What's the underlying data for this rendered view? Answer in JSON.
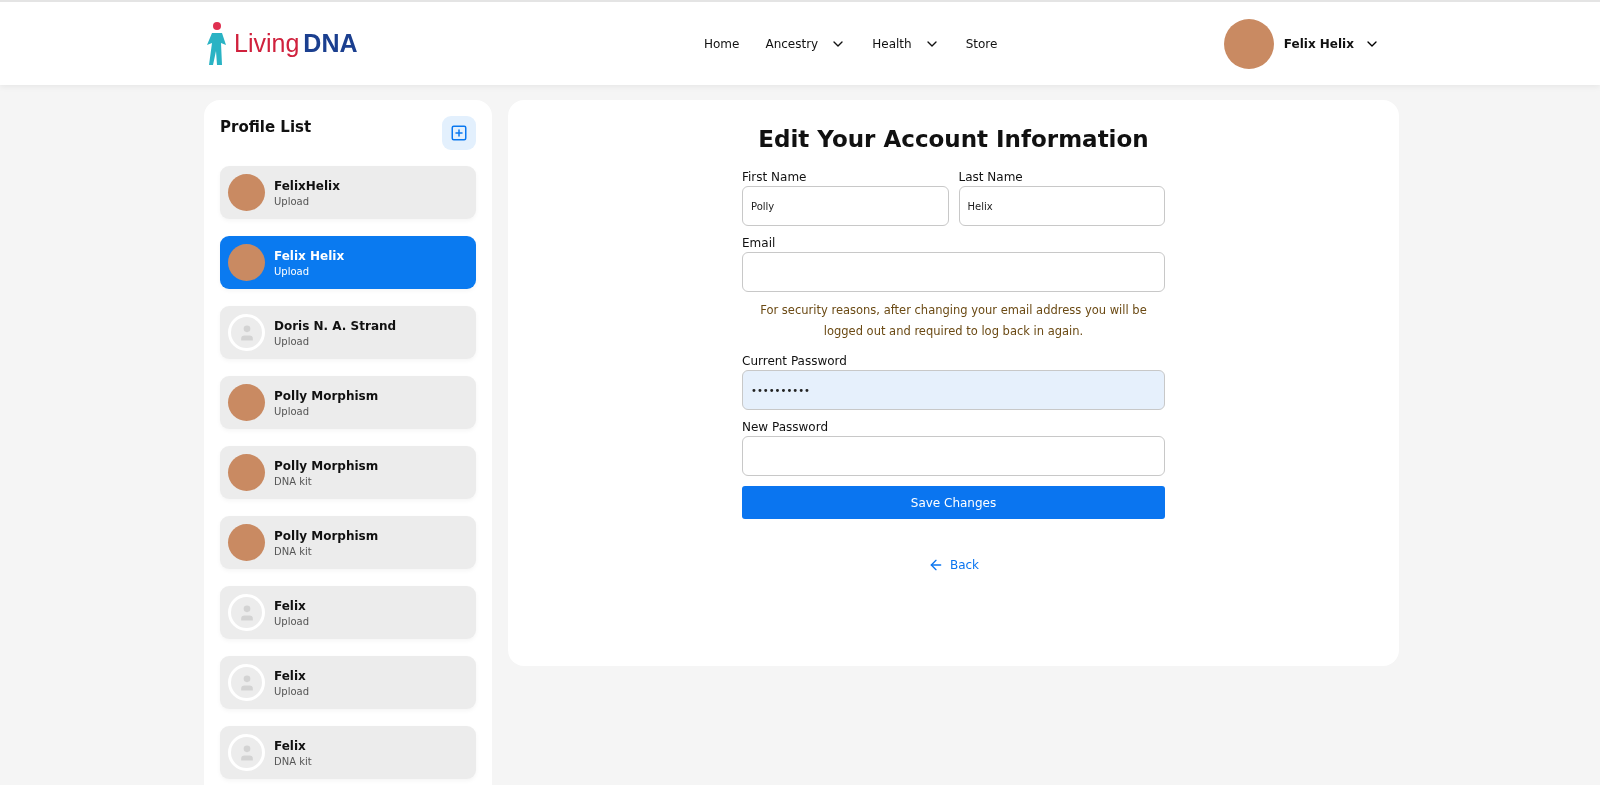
{
  "header": {
    "logo": {
      "word1": "Living",
      "word2": "DNA"
    },
    "nav": [
      {
        "label": "Home",
        "dropdown": false
      },
      {
        "label": "Ancestry",
        "dropdown": true
      },
      {
        "label": "Health",
        "dropdown": true
      },
      {
        "label": "Store",
        "dropdown": false
      }
    ],
    "user": {
      "name": "Felix Helix"
    }
  },
  "sidebar": {
    "title": "Profile List",
    "profiles": [
      {
        "name": "FelixHelix",
        "source": "Upload",
        "kind": "photo",
        "selected": false
      },
      {
        "name": "Felix Helix",
        "source": "Upload",
        "kind": "photo",
        "selected": true
      },
      {
        "name": "Doris N. A. Strand",
        "source": "Upload",
        "kind": "placeholder",
        "selected": false
      },
      {
        "name": "Polly Morphism",
        "source": "Upload",
        "kind": "photo",
        "selected": false
      },
      {
        "name": "Polly Morphism",
        "source": "DNA kit",
        "kind": "photo",
        "selected": false
      },
      {
        "name": "Polly Morphism",
        "source": "DNA kit",
        "kind": "photo",
        "selected": false
      },
      {
        "name": "Felix",
        "source": "Upload",
        "kind": "placeholder",
        "selected": false
      },
      {
        "name": "Felix",
        "source": "Upload",
        "kind": "placeholder",
        "selected": false
      },
      {
        "name": "Felix",
        "source": "DNA kit",
        "kind": "placeholder",
        "selected": false
      }
    ]
  },
  "form": {
    "title": "Edit Your Account Information",
    "name_fields": [
      {
        "label": "First Name",
        "value": "Polly",
        "autofilled": false
      },
      {
        "label": "Last Name",
        "value": "Helix",
        "autofilled": false
      }
    ],
    "email": {
      "label": "Email",
      "autofilled": false
    },
    "notice": "For security reasons, after changing your email address you will be logged out and required to log back in again.",
    "password_fields": [
      {
        "label": "Current Password",
        "value": "••••••••••",
        "autofilled": true
      },
      {
        "label": "New Password",
        "autofilled": false
      }
    ],
    "save_button": "Save Changes",
    "back_link": "Back"
  }
}
